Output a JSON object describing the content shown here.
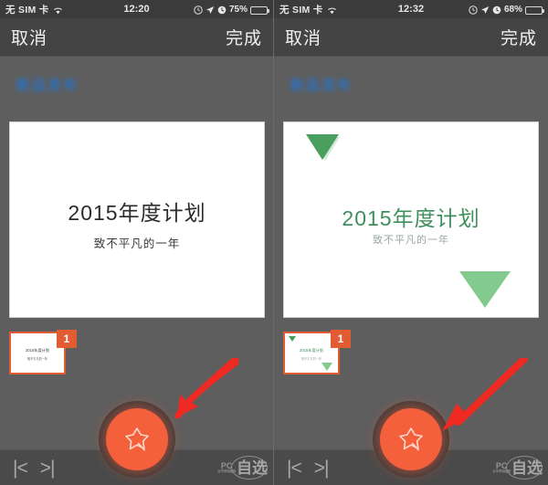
{
  "app": {
    "watermark_pc": "PC",
    "watermark_pc_sub": "太平洋电脑网",
    "watermark_zi": "自选"
  },
  "panels": [
    {
      "id": "left",
      "status_bar": {
        "carrier": "无 SIM 卡",
        "wifi_icon": "wifi-icon",
        "time": "12:20",
        "alarm_icon": "alarm-icon",
        "location_icon": "location-arrow-icon",
        "clock_icon": "clock-icon",
        "battery_percent": "75%",
        "battery_level": 75
      },
      "navbar": {
        "cancel_label": "取消",
        "done_label": "完成"
      },
      "title_strip": {
        "blurred_text": "新品发布"
      },
      "slide": {
        "theme": "plain",
        "title": "2015年度计划",
        "subtitle": "致不平凡的一年",
        "decorations": []
      },
      "thumbnail": {
        "number": "1",
        "title": "2015年度计划",
        "subtitle": "致不平凡的一年",
        "border_color": "#e25b33",
        "badge_color": "#e25b33"
      },
      "bottom_bar": {
        "prev_icon": "|<",
        "next_icon": ">|"
      },
      "magic_button": {
        "icon": "magic-wand-star-icon",
        "color": "#f4603c",
        "ring_color": "#3a3a3a"
      },
      "annotation": {
        "type": "red-arrow",
        "color": "#ee2a23",
        "direction": "down-left"
      }
    },
    {
      "id": "right",
      "status_bar": {
        "carrier": "无 SIM 卡",
        "wifi_icon": "wifi-icon",
        "time": "12:32",
        "alarm_icon": "alarm-icon",
        "location_icon": "location-arrow-icon",
        "clock_icon": "clock-icon",
        "battery_percent": "68%",
        "battery_level": 68
      },
      "navbar": {
        "cancel_label": "取消",
        "done_label": "完成"
      },
      "title_strip": {
        "blurred_text": "新品发布"
      },
      "slide": {
        "theme": "green",
        "title": "2015年度计划",
        "subtitle": "致不平凡的一年",
        "title_color": "#3e8f5c",
        "subtitle_color": "#9aa79e",
        "decorations": [
          "triangle-top-left",
          "triangle-bottom-right"
        ],
        "triangle_dark_color": "#4a9e5e",
        "triangle_light_color": "#82ca8d"
      },
      "thumbnail": {
        "number": "1",
        "title": "2015年度计划",
        "subtitle": "致不平凡的一年",
        "border_color": "#e25b33",
        "badge_color": "#e25b33"
      },
      "bottom_bar": {
        "prev_icon": "|<",
        "next_icon": ">|"
      },
      "magic_button": {
        "icon": "magic-wand-star-icon",
        "color": "#f4603c",
        "ring_color": "#3a3a3a"
      },
      "annotation": {
        "type": "red-arrow",
        "color": "#ee2a23",
        "direction": "down-left"
      }
    }
  ]
}
